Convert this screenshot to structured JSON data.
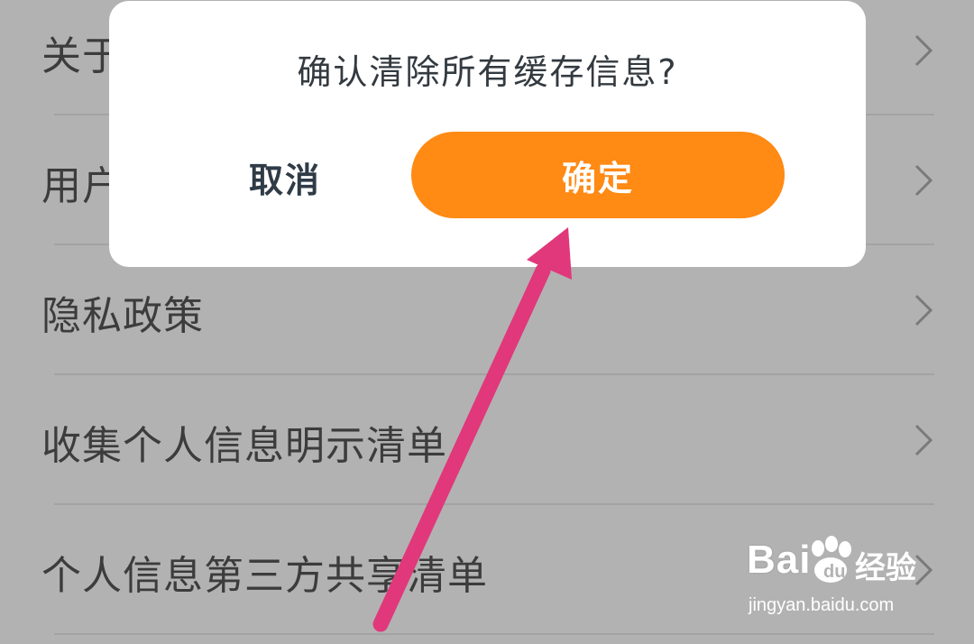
{
  "background_list": {
    "items": [
      {
        "label": "关于"
      },
      {
        "label": "用户"
      },
      {
        "label": "隐私政策"
      },
      {
        "label": "收集个人信息明示清单"
      },
      {
        "label": "个人信息第三方共享清单"
      }
    ]
  },
  "dialog": {
    "title": "确认清除所有缓存信息?",
    "cancel_label": "取消",
    "confirm_label": "确定"
  },
  "colors": {
    "overlay_background": "#b2b2b2",
    "confirm_button": "#ff8a14",
    "annotation_arrow": "#e0387a"
  },
  "icons": {
    "row_chevron": "chevron-right-icon",
    "annotation": "arrow-annotation-icon",
    "watermark_logo": "paw-icon"
  },
  "watermark": {
    "brand_left": "Bai",
    "brand_right": "经验",
    "url": "jingyan.baidu.com"
  }
}
